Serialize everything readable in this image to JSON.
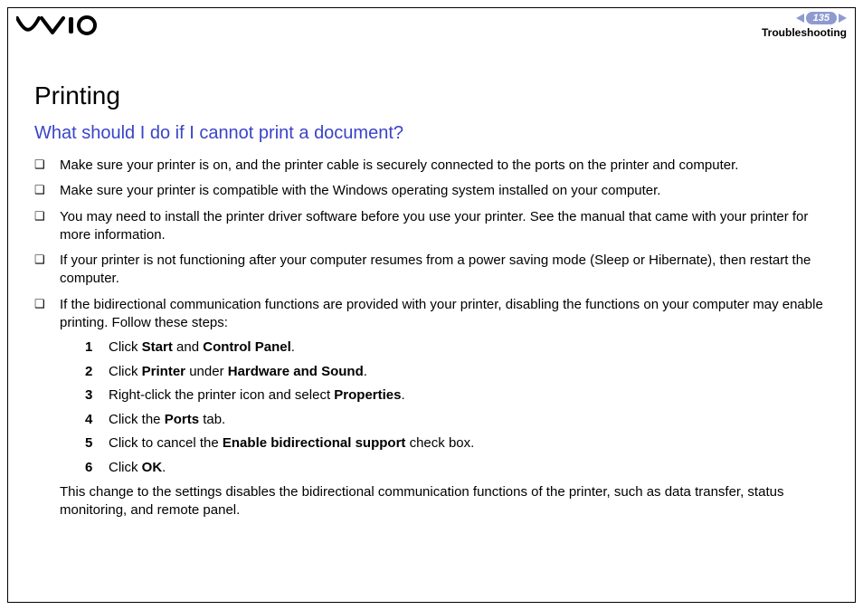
{
  "header": {
    "page_number": "135",
    "section": "Troubleshooting"
  },
  "content": {
    "title": "Printing",
    "subtitle": "What should I do if I cannot print a document?",
    "bullets": [
      "Make sure your printer is on, and the printer cable is securely connected to the ports on the printer and computer.",
      "Make sure your printer is compatible with the Windows operating system installed on your computer.",
      "You may need to install the printer driver software before you use your printer. See the manual that came with your printer for more information.",
      "If your printer is not functioning after your computer resumes from a power saving mode (Sleep or Hibernate), then restart the computer.",
      "If the bidirectional communication functions are provided with your printer, disabling the functions on your computer may enable printing. Follow these steps:"
    ],
    "steps": [
      {
        "n": "1",
        "pre": "Click ",
        "b1": "Start",
        "mid": " and ",
        "b2": "Control Panel",
        "post": "."
      },
      {
        "n": "2",
        "pre": "Click ",
        "b1": "Printer",
        "mid": " under ",
        "b2": "Hardware and Sound",
        "post": "."
      },
      {
        "n": "3",
        "pre": "Right-click the printer icon and select ",
        "b1": "Properties",
        "mid": "",
        "b2": "",
        "post": "."
      },
      {
        "n": "4",
        "pre": "Click the ",
        "b1": "Ports",
        "mid": "",
        "b2": "",
        "post": " tab."
      },
      {
        "n": "5",
        "pre": "Click to cancel the ",
        "b1": "Enable bidirectional support",
        "mid": "",
        "b2": "",
        "post": " check box."
      },
      {
        "n": "6",
        "pre": "Click ",
        "b1": "OK",
        "mid": "",
        "b2": "",
        "post": "."
      }
    ],
    "trailing": "This change to the settings disables the bidirectional communication functions of the printer, such as data transfer, status monitoring, and remote panel."
  }
}
